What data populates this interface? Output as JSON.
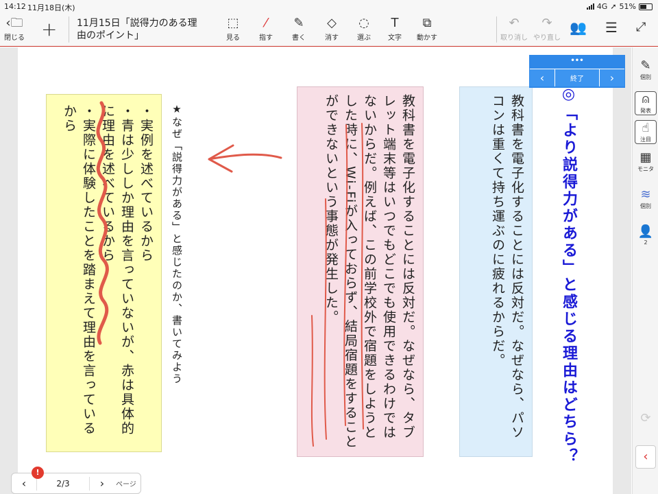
{
  "status_bar": {
    "time": "14:12",
    "date": "11月18日(木)",
    "network": "4G",
    "battery": "51%"
  },
  "toolbar": {
    "close_label": "閉じる",
    "doc_title_line1": "11月15日「説得力のある理",
    "doc_title_line2": "由のポイント」",
    "tools": [
      {
        "label": "見る",
        "icon": "view-icon"
      },
      {
        "label": "指す",
        "icon": "pointer-pen-icon"
      },
      {
        "label": "書く",
        "icon": "pen-icon"
      },
      {
        "label": "消す",
        "icon": "eraser-icon"
      },
      {
        "label": "選ぶ",
        "icon": "lasso-icon"
      },
      {
        "label": "文字",
        "icon": "text-icon"
      },
      {
        "label": "動かす",
        "icon": "move-icon"
      }
    ],
    "undo_label": "取り消し",
    "redo_label": "やり直し"
  },
  "sidebar": {
    "items": [
      {
        "label": "個別",
        "icon": "edit-note-icon"
      },
      {
        "label": "発表",
        "icon": "presenter-icon"
      },
      {
        "label": "注目",
        "icon": "hand-icon"
      },
      {
        "label": "モニタ",
        "icon": "grid-icon"
      },
      {
        "label": "個別",
        "icon": "layers-icon"
      },
      {
        "label": "2",
        "icon": "person-icon"
      }
    ]
  },
  "presenter": {
    "dots": "•••",
    "end_label": "終了"
  },
  "content": {
    "heading": "◎「より説得力がある」と感じる理由はどちら？",
    "blue_card": "教科書を電子化することには反対だ。なぜなら、パソコンは重くて持ち運ぶのに疲れるからだ。",
    "pink_card": "教科書を電子化することには反対だ。なぜなら、タブレット端末等はいつでもどこでも使用できるわけではないからだ。例えば、この前学校外で宿題をしようとした時に、Wi-Fiが入っておらず、結局宿題をすることができないという事態が発生した。",
    "question": "★なぜ「説得力がある」と感じたのか、書いてみよう",
    "yellow_lines": [
      "・実例を述べているから",
      "・青は少ししか理由を言っていないが、赤は具体的に理由を述べているから",
      "・実際に体験したことを踏まえて理由を言っているから"
    ]
  },
  "pager": {
    "current": "2/3",
    "label": "ページ",
    "badge": "!"
  },
  "colors": {
    "accent_red": "#e05a4a",
    "heading_blue": "#1a1ad6",
    "presenter_blue": "#2f88e8"
  }
}
